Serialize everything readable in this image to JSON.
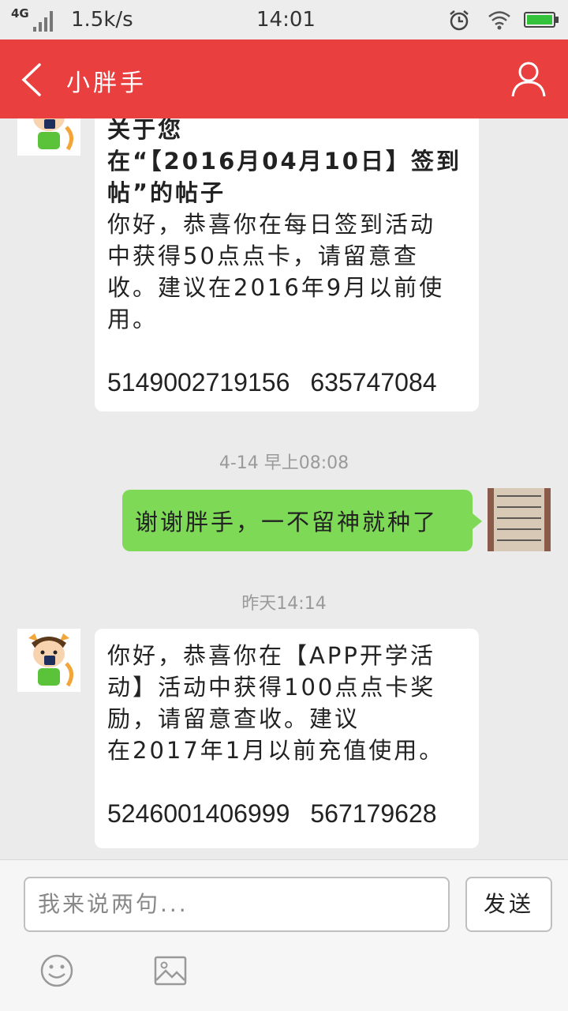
{
  "status_bar": {
    "network": "4G",
    "speed": "1.5k/s",
    "time": "14:01"
  },
  "header": {
    "title": "小胖手"
  },
  "messages": {
    "first": {
      "line1": "关于您",
      "line2": "在“【2016月04月10日】签到",
      "line3": "帖”的帖子",
      "line4": "你好，恭喜你在每日签到活动",
      "line5": "中获得50点点卡，请留意查",
      "line6": "收。建议在2016年9月以前使",
      "line7": "用。",
      "code_a": "5149002719156",
      "code_b": "635747084"
    },
    "time1": "4-14 早上08:08",
    "sent": "谢谢胖手，一不留神就种了",
    "time2": "昨天14:14",
    "second": {
      "line1": "你好，恭喜你在【APP开学活",
      "line2": "动】活动中获得100点点卡奖",
      "line3": "励，请留意查收。建议",
      "line4": "在2017年1月以前充值使用。",
      "code_a": "5246001406999",
      "code_b": "567179628"
    }
  },
  "input": {
    "placeholder": "我来说两句...",
    "send_label": "发送"
  },
  "colors": {
    "header": "#ea3f3f",
    "sent_bubble": "#7ed957",
    "background": "#ebebeb"
  },
  "icons": {
    "back": "chevron-left-icon",
    "user": "user-icon",
    "emoji": "emoji-icon",
    "image": "image-icon"
  }
}
